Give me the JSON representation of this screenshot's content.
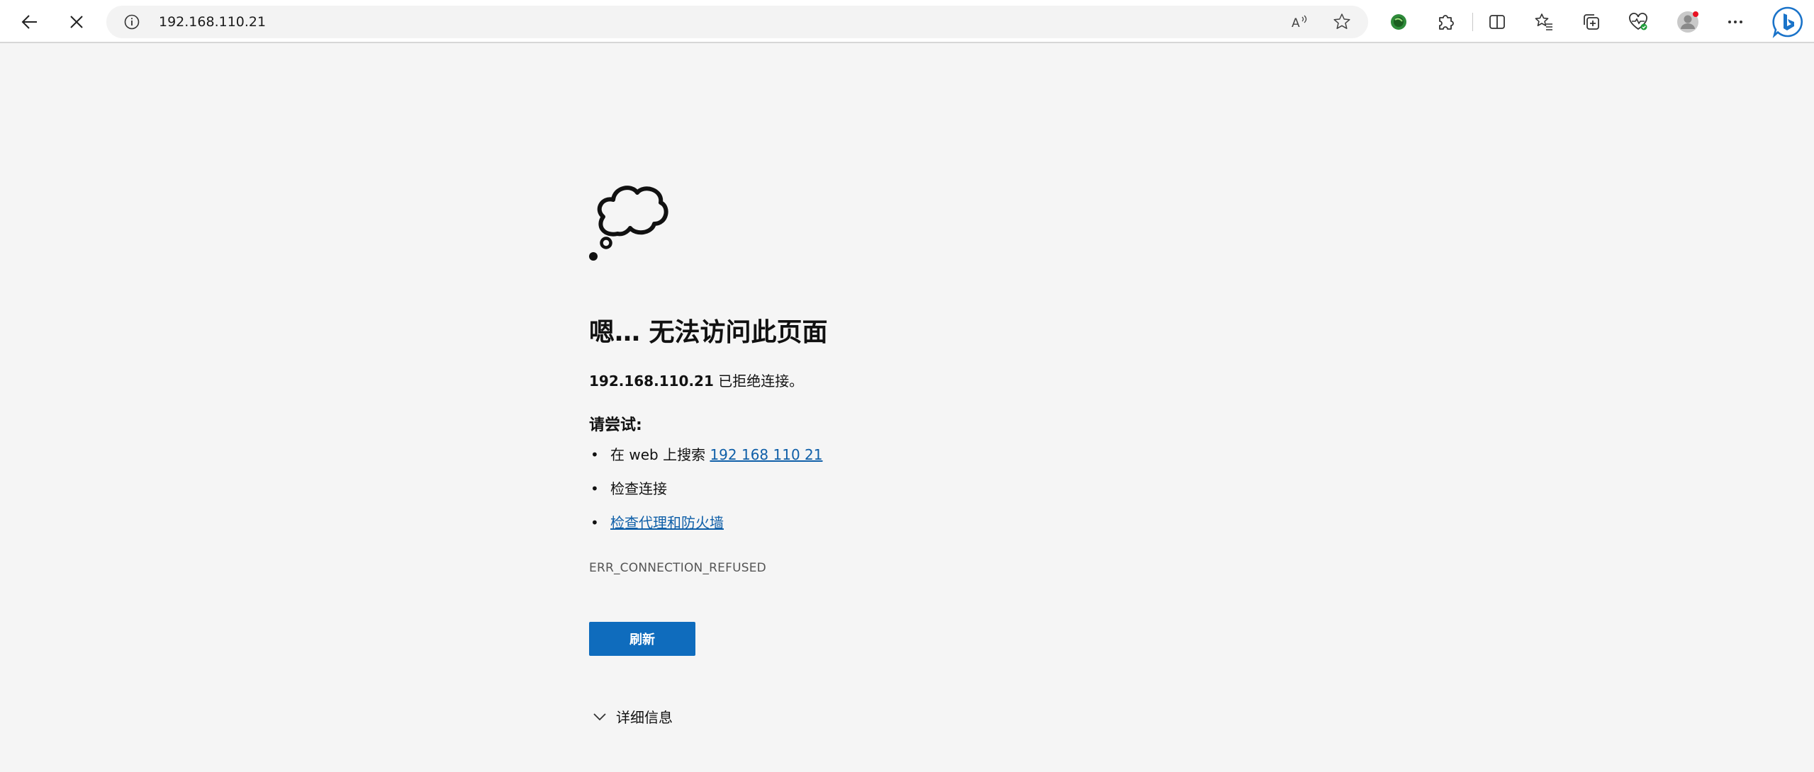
{
  "browser": {
    "address_url": "192.168.110.21",
    "icons": [
      "back-arrow-icon",
      "stop-loading-icon",
      "site-info-icon",
      "read-aloud-icon",
      "add-favorite-icon",
      "extension-green-icon",
      "extensions-icon",
      "split-screen-icon",
      "favorites-icon",
      "collections-icon",
      "browser-essentials-icon",
      "profile-avatar-icon",
      "more-options-icon",
      "bing-copilot-icon"
    ]
  },
  "error_page": {
    "headline": "嗯… 无法访问此页面",
    "host": "192.168.110.21",
    "refused_text": " 已拒绝连接。",
    "try_label": "请尝试:",
    "suggestions": {
      "search_prefix": "在 web 上搜索 ",
      "search_link": "192 168 110 21",
      "check_connection": "检查连接",
      "check_proxy": "检查代理和防火墙"
    },
    "error_code": "ERR_CONNECTION_REFUSED",
    "refresh_label": "刷新",
    "details_label": "详细信息"
  },
  "colors": {
    "accent": "#0f6cbd",
    "link": "#0f5fa8",
    "background": "#f5f5f5"
  }
}
